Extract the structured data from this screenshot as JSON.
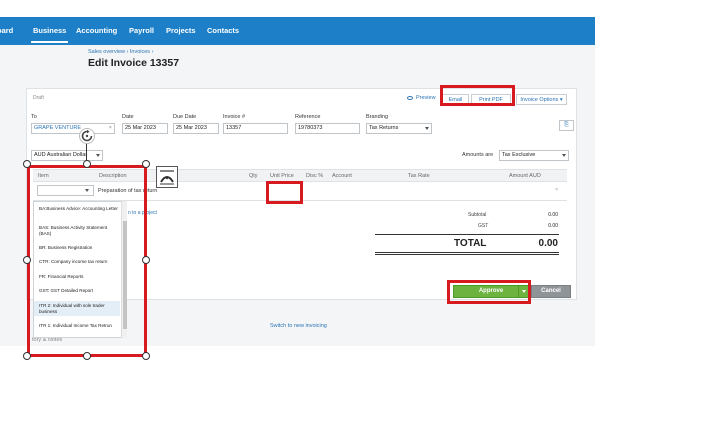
{
  "nav": {
    "items": [
      "oard",
      "Business",
      "Accounting",
      "Payroll",
      "Projects",
      "Contacts"
    ],
    "active": "Business"
  },
  "breadcrumb": "Sales overview › Invoices ›",
  "page_title": "Edit Invoice 13357",
  "status": "Draft",
  "actions": {
    "preview": "Preview",
    "email": "Email",
    "print_pdf": "Print PDF",
    "invoice_options": "Invoice Options ▾"
  },
  "form": {
    "to_label": "To",
    "to_value": "GRAPE VENTURE",
    "date_label": "Date",
    "date_value": "25 Mar 2023",
    "due_label": "Due Date",
    "due_value": "25 Mar 2023",
    "invoice_label": "Invoice #",
    "invoice_value": "13357",
    "reference_label": "Reference",
    "reference_value": "19780373",
    "branding_label": "Branding",
    "branding_value": "Tax Returns",
    "currency_value": "AUD Australian Dollar",
    "amounts_label": "Amounts are",
    "amounts_value": "Tax Exclusive"
  },
  "table": {
    "headers": [
      "Item",
      "Description",
      "Qty",
      "Unit Price",
      "Disc %",
      "Account",
      "Tax Rate",
      "Amount AUD"
    ],
    "row_description": "Preparation of tax return",
    "add_link": "n to a project"
  },
  "totals": {
    "subtotal_label": "Subtotal",
    "subtotal_value": "0.00",
    "gst_label": "GST",
    "gst_value": "0.00",
    "total_label": "TOTAL",
    "total_value": "0.00"
  },
  "dropdown_items": [
    "BA:Business Advice: Accounting Letter",
    "BAS: Business Activity Statement (BAS)",
    "BR: Business Registration",
    "CTR: Company income tax return",
    "FR: Financial Reports",
    "GST: GST Detailed Report",
    "ITR 2: Individual with sole trader business",
    "ITR 1: Individual Income Tax Retrun"
  ],
  "dropdown_selected_index": 6,
  "buttons": {
    "approve": "Approve",
    "cancel": "Cancel"
  },
  "switch_link": "Switch to new invoicing",
  "history": "tory & Notes",
  "colors": {
    "nav": "#1c7fc8",
    "approve": "#6cb33f",
    "annotation": "#d71920"
  }
}
